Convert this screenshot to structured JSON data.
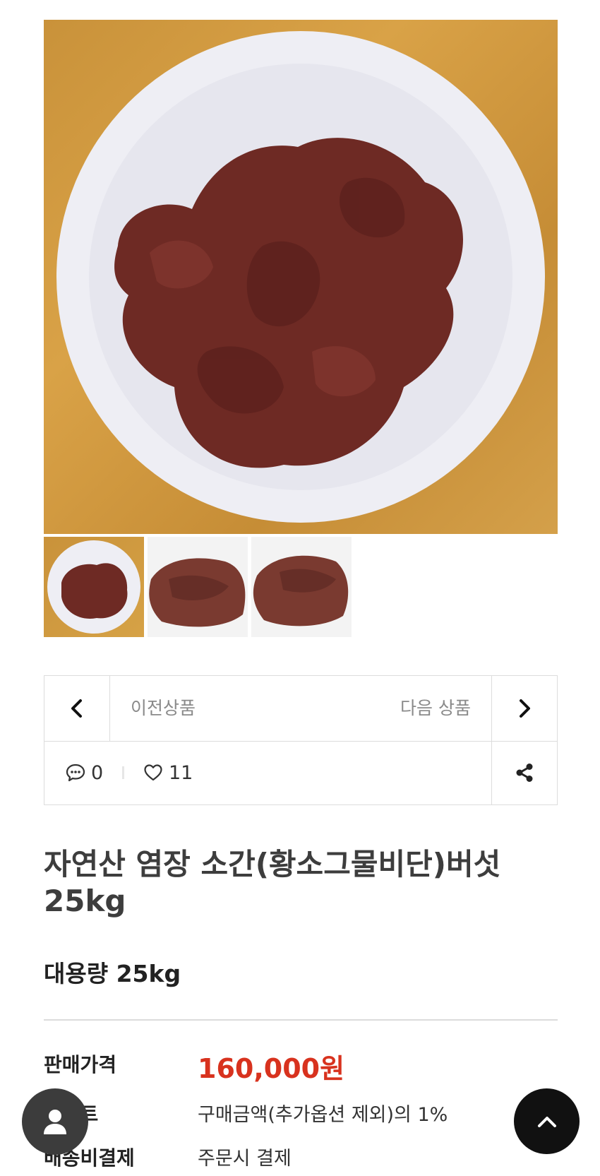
{
  "gallery": {
    "main_image": "beef-liver-on-plate",
    "thumbnails": [
      "beef-liver-on-plate",
      "beef-liver-close-up-1",
      "beef-liver-close-up-2"
    ]
  },
  "product_nav": {
    "prev_label": "이전상품",
    "next_label": "다음 상품"
  },
  "stats": {
    "comment_count": "0",
    "like_count": "11"
  },
  "product": {
    "title": "자연산 염장 소간(황소그물비단)버섯 25kg",
    "subtitle": "대용량 25kg"
  },
  "info": {
    "price_label": "판매가격",
    "price_value": "160,000원",
    "point_label": "포인트",
    "point_value": "구매금액(추가옵션 제외)의 1%",
    "shipping_label": "배송비결제",
    "shipping_value": "주문시 결제"
  },
  "colors": {
    "price": "#d8321e",
    "border": "#dcdcdc",
    "fab_dark": "#111111"
  },
  "icons": [
    "chevron-left-icon",
    "chevron-right-icon",
    "comment-icon",
    "heart-icon",
    "share-icon",
    "user-icon",
    "arrow-up-icon"
  ]
}
